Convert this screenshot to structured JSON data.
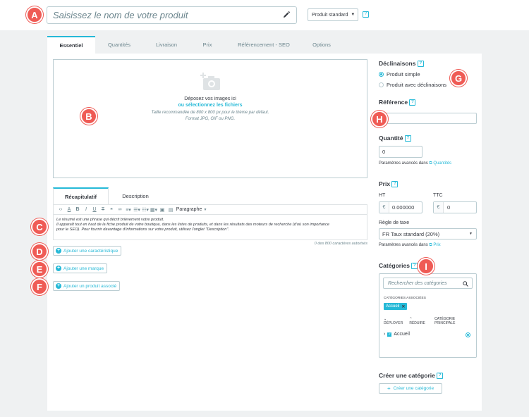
{
  "header": {
    "product_name_placeholder": "Saisissez le nom de votre produit",
    "product_type": "Produit standard",
    "help_glyph": "?"
  },
  "markers": [
    "A",
    "B",
    "C",
    "D",
    "E",
    "F",
    "G",
    "H",
    "I"
  ],
  "tabs": [
    {
      "label": "Essentiel",
      "active": true
    },
    {
      "label": "Quantités",
      "active": false
    },
    {
      "label": "Livraison",
      "active": false
    },
    {
      "label": "Prix",
      "active": false
    },
    {
      "label": "Référencement - SEO",
      "active": false
    },
    {
      "label": "Options",
      "active": false
    }
  ],
  "dropzone": {
    "line1": "Déposez vos images ici",
    "line2": "ou sélectionnez les fichiers",
    "line3": "Taille recommandée de 800 x 800 px pour le thème par défaut.",
    "line4": "Format JPG, GIF ou PNG."
  },
  "subtabs": [
    {
      "label": "Récapitulatif",
      "active": true
    },
    {
      "label": "Description",
      "active": false
    }
  ],
  "editor": {
    "paragraph_select": "Paragraphe",
    "text_line1": "Le résumé est une phrase qui décrit brièvement votre produit.",
    "text_line2": "Il apparaît tout en haut de la fiche produit de votre boutique, dans les listes de produits, et dans les résultats des moteurs de recherche (d'où son importance",
    "text_line3": "pour le SEO). Pour fournir davantage d'informations sur votre produit, utilisez l'onglet \"Description\".",
    "char_count": "0 des 800 caractères autorisés"
  },
  "buttons": {
    "add_feature": "Ajouter une caractéristique",
    "add_brand": "Ajouter une marque",
    "add_related": "Ajouter un produit associé"
  },
  "sidebar": {
    "declinaisons_title": "Déclinaisons",
    "radio_simple": "Produit simple",
    "radio_variants": "Produit avec déclinaisons",
    "reference_title": "Référence",
    "reference_value": "",
    "quantity_title": "Quantité",
    "quantity_value": "0",
    "advanced_params": "Paramètres avancés dans",
    "quantities_link": "Quantités",
    "price_title": "Prix",
    "ht_label": "HT",
    "ttc_label": "TTC",
    "currency": "€",
    "ht_value": "0.000000",
    "ttc_value": "0",
    "tax_rule_label": "Règle de taxe",
    "tax_rule_value": "FR Taux standard (20%)",
    "price_link": "Prix",
    "categories_title": "Catégories",
    "category_search_placeholder": "Rechercher des catégories",
    "associated_label": "CATÉGORIES ASSOCIÉES",
    "associated_tag": "Accueil",
    "expand": "DÉPLOYER",
    "collapse": "RÉDUIRE",
    "main_category": "CATÉGORIE PRINCIPALE",
    "tree_item": "Accueil",
    "create_category_title": "Créer une catégorie",
    "create_category_button": "Créer une catégorie"
  },
  "colors": {
    "accent": "#25b9d7",
    "marker": "#ef5b55",
    "text": "#363a41",
    "muted": "#6c868e",
    "border": "#bbcdd2",
    "bg": "#eff1f2"
  },
  "icons": [
    "pencil-icon",
    "camera-icon",
    "search-icon",
    "plus-circle-icon",
    "external-link-icon",
    "help-icon",
    "close-icon",
    "chevron-down-icon",
    "chevron-up-icon",
    "chevron-right-icon"
  ]
}
